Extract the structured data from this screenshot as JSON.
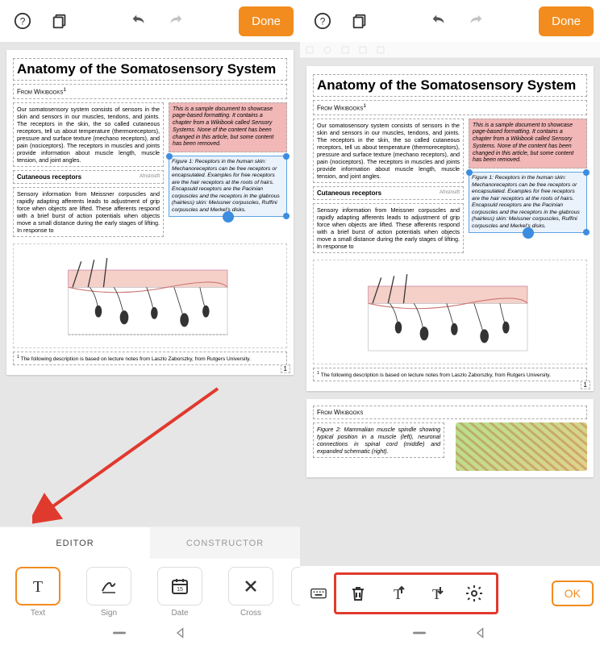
{
  "topbar": {
    "done": "Done"
  },
  "doc": {
    "title": "Anatomy of the Somatosensory System",
    "subtitle": "From Wikibooks",
    "subtitle_sup": "1",
    "p1": "Our somatosensory system consists of sensors in the skin and sensors in our muscles, tendons, and joints. The receptors in the skin, the so called cutaneous receptors, tell us about temperature (thermoreceptors), pressure and surface texture (mechano receptors), and pain (nociceptors). The receptors in muscles and joints provide information about muscle length, muscle tension, and joint angles.",
    "h2": "Cutaneous receptors",
    "h2_side": "Afnstnstft",
    "p2": "Sensory information from Meissner corpuscles and rapidly adapting afferents leads to adjustment of grip force when objects are lifted. These afferents respond with a brief burst of action potentials when objects move a small distance during the early stages of lifting. In response to",
    "pinkbox": "This is a sample document to showcase page-based formatting. It contains a chapter from a Wikibook called Sensory Systems. None of the content has been changed in this article, but some content has been removed.",
    "figcaption": "Figure 1: Receptors in the human skin: Mechanoreceptors can be free receptors or encapsulated. Examples for free receptors are the hair receptors at the roots of hairs. Encapsuld receptors are the Pacinian corpuscles and the receptors in the glabrous (hairless) skin: Meissner corpuscles, Ruffini corpuscles and Merkel's disks.",
    "footnote": "The following description is based on lecture notes from Laszlo Zaborszky, from Rutgers University.",
    "footnote_sup": "1",
    "pagenum": "1"
  },
  "tabs": {
    "editor": "EDITOR",
    "constructor": "CONSTRUCTOR"
  },
  "tools": {
    "text": "Text",
    "sign": "Sign",
    "date": "Date",
    "cross": "Cross",
    "date_num": "15"
  },
  "page2": {
    "subtitle": "From Wikibooks",
    "caption": "Figure 2: Mammalian muscle spindle showing typical position in a muscle (left), neuronal connections in spinal cord (middle) and expanded schematic (right)."
  },
  "actions": {
    "ok": "OK"
  }
}
